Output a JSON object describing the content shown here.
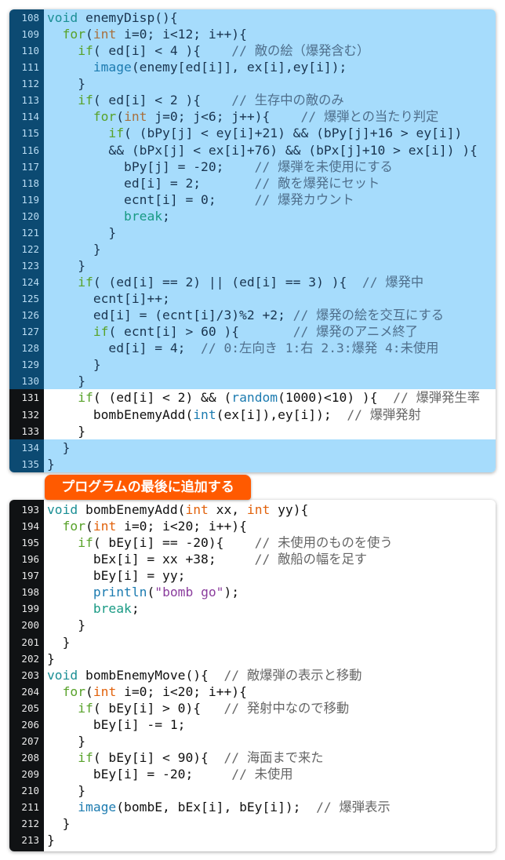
{
  "colors": {
    "highlight_bg": "#a6dcfc",
    "gutter_highlight": "#0c4a72",
    "gutter_dark": "#101214",
    "label_bg": "#ff5a00",
    "keyword": "#1b8f95",
    "control": "#58a22a",
    "function": "#1c7bb0",
    "string": "#8b3d9d"
  },
  "label": "プログラムの最後に追加する",
  "listing1": [
    {
      "n": "108",
      "hl": true,
      "t": [
        [
          "k",
          "void"
        ],
        [
          "p",
          " enemyDisp(){"
        ]
      ]
    },
    {
      "n": "109",
      "hl": true,
      "t": [
        [
          "p",
          "  "
        ],
        [
          "c",
          "for"
        ],
        [
          "p",
          "("
        ],
        [
          "t",
          "int"
        ],
        [
          "p",
          " i=0; i<12; i++){"
        ]
      ]
    },
    {
      "n": "110",
      "hl": true,
      "t": [
        [
          "p",
          "    "
        ],
        [
          "c",
          "if"
        ],
        [
          "p",
          "( ed[i] < 4 ){    "
        ],
        [
          "m",
          "// 敵の絵（爆発含む）"
        ]
      ]
    },
    {
      "n": "111",
      "hl": true,
      "t": [
        [
          "p",
          "      "
        ],
        [
          "f",
          "image"
        ],
        [
          "p",
          "(enemy[ed[i]], ex[i],ey[i]);"
        ]
      ]
    },
    {
      "n": "112",
      "hl": true,
      "t": [
        [
          "p",
          "    }"
        ]
      ]
    },
    {
      "n": "113",
      "hl": true,
      "t": [
        [
          "p",
          "    "
        ],
        [
          "c",
          "if"
        ],
        [
          "p",
          "( ed[i] < 2 ){    "
        ],
        [
          "m",
          "// 生存中の敵のみ"
        ]
      ]
    },
    {
      "n": "114",
      "hl": true,
      "t": [
        [
          "p",
          "      "
        ],
        [
          "c",
          "for"
        ],
        [
          "p",
          "("
        ],
        [
          "t",
          "int"
        ],
        [
          "p",
          " j=0; j<6; j++){    "
        ],
        [
          "m",
          "// 爆弾との当たり判定"
        ]
      ]
    },
    {
      "n": "115",
      "hl": true,
      "t": [
        [
          "p",
          "        "
        ],
        [
          "c",
          "if"
        ],
        [
          "p",
          "( (bPy[j] < ey[i]+21) && (bPy[j]+16 > ey[i])"
        ]
      ]
    },
    {
      "n": "116",
      "hl": true,
      "t": [
        [
          "p",
          "        && (bPx[j] < ex[i]+76) && (bPx[j]+10 > ex[i]) ){"
        ]
      ]
    },
    {
      "n": "117",
      "hl": true,
      "t": [
        [
          "p",
          "          bPy[j] = -20;    "
        ],
        [
          "m",
          "// 爆弾を未使用にする"
        ]
      ]
    },
    {
      "n": "118",
      "hl": true,
      "t": [
        [
          "p",
          "          ed[i] = 2;       "
        ],
        [
          "m",
          "// 敵を爆発にセット"
        ]
      ]
    },
    {
      "n": "119",
      "hl": true,
      "t": [
        [
          "p",
          "          ecnt[i] = 0;     "
        ],
        [
          "m",
          "// 爆発カウント"
        ]
      ]
    },
    {
      "n": "120",
      "hl": true,
      "t": [
        [
          "p",
          "          "
        ],
        [
          "b",
          "break"
        ],
        [
          "p",
          ";"
        ]
      ]
    },
    {
      "n": "121",
      "hl": true,
      "t": [
        [
          "p",
          "        }"
        ]
      ]
    },
    {
      "n": "122",
      "hl": true,
      "t": [
        [
          "p",
          "      }"
        ]
      ]
    },
    {
      "n": "123",
      "hl": true,
      "t": [
        [
          "p",
          "    }"
        ]
      ]
    },
    {
      "n": "124",
      "hl": true,
      "t": [
        [
          "p",
          "    "
        ],
        [
          "c",
          "if"
        ],
        [
          "p",
          "( (ed[i] == 2) || (ed[i] == 3) ){  "
        ],
        [
          "m",
          "// 爆発中"
        ]
      ]
    },
    {
      "n": "125",
      "hl": true,
      "t": [
        [
          "p",
          "      ecnt[i]++;"
        ]
      ]
    },
    {
      "n": "126",
      "hl": true,
      "t": [
        [
          "p",
          "      ed[i] = (ecnt[i]/3)%2 +2; "
        ],
        [
          "m",
          "// 爆発の絵を交互にする"
        ]
      ]
    },
    {
      "n": "127",
      "hl": true,
      "t": [
        [
          "p",
          "      "
        ],
        [
          "c",
          "if"
        ],
        [
          "p",
          "( ecnt[i] > 60 ){       "
        ],
        [
          "m",
          "// 爆発のアニメ終了"
        ]
      ]
    },
    {
      "n": "128",
      "hl": true,
      "t": [
        [
          "p",
          "        ed[i] = 4;  "
        ],
        [
          "m",
          "// 0:左向き 1:右 2.3:爆発 4:未使用"
        ]
      ]
    },
    {
      "n": "129",
      "hl": true,
      "t": [
        [
          "p",
          "      }"
        ]
      ]
    },
    {
      "n": "130",
      "hl": true,
      "t": [
        [
          "p",
          "    }"
        ]
      ]
    },
    {
      "n": "131",
      "hl": false,
      "t": [
        [
          "p",
          "    "
        ],
        [
          "c",
          "if"
        ],
        [
          "p",
          "( (ed[i] < 2) && ("
        ],
        [
          "f",
          "random"
        ],
        [
          "p",
          "(1000)<10) ){  "
        ],
        [
          "m",
          "// 爆弾発生率"
        ]
      ]
    },
    {
      "n": "132",
      "hl": false,
      "t": [
        [
          "p",
          "      bombEnemyAdd("
        ],
        [
          "f",
          "int"
        ],
        [
          "p",
          "(ex[i]),ey[i]);  "
        ],
        [
          "m",
          "// 爆弾発射"
        ]
      ]
    },
    {
      "n": "133",
      "hl": false,
      "t": [
        [
          "p",
          "    }"
        ]
      ]
    },
    {
      "n": "134",
      "hl": true,
      "t": [
        [
          "p",
          "  }"
        ]
      ]
    },
    {
      "n": "135",
      "hl": true,
      "t": [
        [
          "p",
          "}"
        ]
      ]
    }
  ],
  "listing2": [
    {
      "n": "193",
      "hl": false,
      "t": [
        [
          "k",
          "void"
        ],
        [
          "p",
          " bombEnemyAdd("
        ],
        [
          "t",
          "int"
        ],
        [
          "p",
          " xx, "
        ],
        [
          "t",
          "int"
        ],
        [
          "p",
          " yy){"
        ]
      ]
    },
    {
      "n": "194",
      "hl": false,
      "t": [
        [
          "p",
          "  "
        ],
        [
          "c",
          "for"
        ],
        [
          "p",
          "("
        ],
        [
          "t",
          "int"
        ],
        [
          "p",
          " i=0; i<20; i++){"
        ]
      ]
    },
    {
      "n": "195",
      "hl": false,
      "t": [
        [
          "p",
          "    "
        ],
        [
          "c",
          "if"
        ],
        [
          "p",
          "( bEy[i] == -20){    "
        ],
        [
          "m",
          "// 未使用のものを使う"
        ]
      ]
    },
    {
      "n": "196",
      "hl": false,
      "t": [
        [
          "p",
          "      bEx[i] = xx +38;     "
        ],
        [
          "m",
          "// 敵船の幅を足す"
        ]
      ]
    },
    {
      "n": "197",
      "hl": false,
      "t": [
        [
          "p",
          "      bEy[i] = yy;"
        ]
      ]
    },
    {
      "n": "198",
      "hl": false,
      "t": [
        [
          "p",
          "      "
        ],
        [
          "f",
          "println"
        ],
        [
          "p",
          "("
        ],
        [
          "s",
          "\"bomb go\""
        ],
        [
          "p",
          ");"
        ]
      ]
    },
    {
      "n": "199",
      "hl": false,
      "t": [
        [
          "p",
          "      "
        ],
        [
          "b",
          "break"
        ],
        [
          "p",
          ";"
        ]
      ]
    },
    {
      "n": "200",
      "hl": false,
      "t": [
        [
          "p",
          "    }"
        ]
      ]
    },
    {
      "n": "201",
      "hl": false,
      "t": [
        [
          "p",
          "  }"
        ]
      ]
    },
    {
      "n": "202",
      "hl": false,
      "t": [
        [
          "p",
          "}"
        ]
      ]
    },
    {
      "n": "203",
      "hl": false,
      "t": [
        [
          "k",
          "void"
        ],
        [
          "p",
          " bombEnemyMove(){  "
        ],
        [
          "m",
          "// 敵爆弾の表示と移動"
        ]
      ]
    },
    {
      "n": "204",
      "hl": false,
      "t": [
        [
          "p",
          "  "
        ],
        [
          "c",
          "for"
        ],
        [
          "p",
          "("
        ],
        [
          "t",
          "int"
        ],
        [
          "p",
          " i=0; i<20; i++){"
        ]
      ]
    },
    {
      "n": "205",
      "hl": false,
      "t": [
        [
          "p",
          "    "
        ],
        [
          "c",
          "if"
        ],
        [
          "p",
          "( bEy[i] > 0){   "
        ],
        [
          "m",
          "// 発射中なので移動"
        ]
      ]
    },
    {
      "n": "206",
      "hl": false,
      "t": [
        [
          "p",
          "      bEy[i] -= 1;"
        ]
      ]
    },
    {
      "n": "207",
      "hl": false,
      "t": [
        [
          "p",
          "    }"
        ]
      ]
    },
    {
      "n": "208",
      "hl": false,
      "t": [
        [
          "p",
          "    "
        ],
        [
          "c",
          "if"
        ],
        [
          "p",
          "( bEy[i] < 90){  "
        ],
        [
          "m",
          "// 海面まで来た"
        ]
      ]
    },
    {
      "n": "209",
      "hl": false,
      "t": [
        [
          "p",
          "      bEy[i] = -20;     "
        ],
        [
          "m",
          "// 未使用"
        ]
      ]
    },
    {
      "n": "210",
      "hl": false,
      "t": [
        [
          "p",
          "    }"
        ]
      ]
    },
    {
      "n": "211",
      "hl": false,
      "t": [
        [
          "p",
          "    "
        ],
        [
          "f",
          "image"
        ],
        [
          "p",
          "(bombE, bEx[i], bEy[i]);  "
        ],
        [
          "m",
          "// 爆弾表示"
        ]
      ]
    },
    {
      "n": "212",
      "hl": false,
      "t": [
        [
          "p",
          "  }"
        ]
      ]
    },
    {
      "n": "213",
      "hl": false,
      "t": [
        [
          "p",
          "}"
        ]
      ]
    }
  ]
}
